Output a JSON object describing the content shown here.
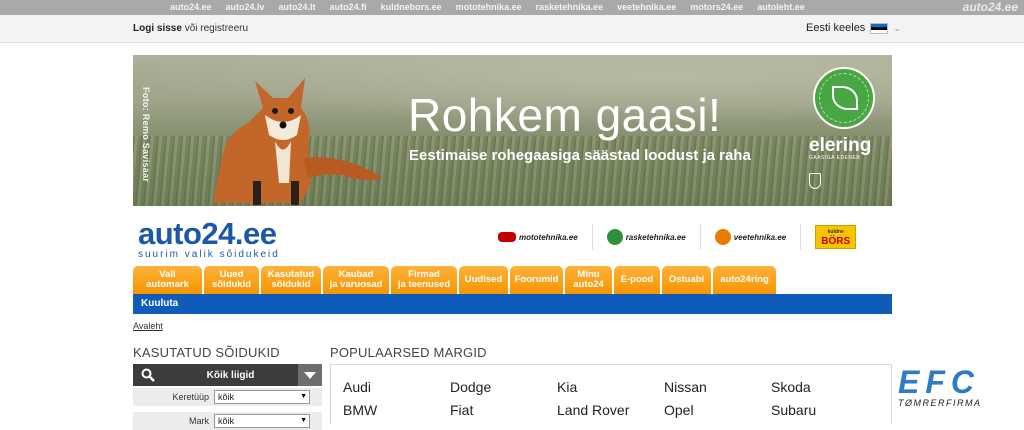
{
  "network": {
    "links": [
      "auto24.ee",
      "auto24.lv",
      "auto24.lt",
      "auto24.fi",
      "kuldnebors.ee",
      "mototehnika.ee",
      "rasketehnika.ee",
      "veetehnika.ee",
      "motors24.ee",
      "autoleht.ee"
    ],
    "brand": "auto24.ee"
  },
  "userbar": {
    "login": "Logi sisse",
    "or_register": "või registreeru",
    "language": "Eesti keeles"
  },
  "banner": {
    "credit": "Foto: Remo Savisaar",
    "headline": "Rohkem gaasi!",
    "subline": "Eestimaise rohegaasiga säästad loodust ja raha",
    "sponsor": "elering",
    "sponsor_sub": "GAASIGA EDENEB"
  },
  "site": {
    "logo": "auto24.ee",
    "tagline": "suurim valik sõidukeid"
  },
  "partners": [
    {
      "label": "mototehnika.ee",
      "color": "#c40000"
    },
    {
      "label": "rasketehnika.ee",
      "color": "#2f8f3a"
    },
    {
      "label": "veetehnika.ee",
      "color": "#e87c00"
    }
  ],
  "bors": {
    "top": "kuldne",
    "main": "BÖRS"
  },
  "tabs": [
    {
      "l1": "Vali",
      "l2": "automark"
    },
    {
      "l1": "Uued",
      "l2": "sõidukid"
    },
    {
      "l1": "Kasutatud",
      "l2": "sõidukid"
    },
    {
      "l1": "Kaubad",
      "l2": "ja varuosad"
    },
    {
      "l1": "Firmad",
      "l2": "ja teenused"
    },
    {
      "l1": "Uudised",
      "l2": ""
    },
    {
      "l1": "Foorumid",
      "l2": ""
    },
    {
      "l1": "Minu",
      "l2": "auto24"
    },
    {
      "l1": "E-pood",
      "l2": ""
    },
    {
      "l1": "Ostuabi",
      "l2": ""
    },
    {
      "l1": "auto24ring",
      "l2": ""
    }
  ],
  "subnav": {
    "label": "Kuuluta"
  },
  "breadcrumb": "Avaleht",
  "search": {
    "title": "KASUTATUD SÕIDUKID",
    "category": "Kõik liigid",
    "filters": [
      {
        "label": "Keretüüp",
        "value": "kõik"
      },
      {
        "label": "Mark",
        "value": "kõik"
      }
    ]
  },
  "popular": {
    "title": "POPULAARSED MARGID",
    "brands": [
      "Audi",
      "Dodge",
      "Kia",
      "Nissan",
      "Skoda",
      "BMW",
      "Fiat",
      "Land Rover",
      "Opel",
      "Subaru"
    ]
  },
  "ad": {
    "big": "EFC",
    "small": "TØMRERFIRMA"
  }
}
